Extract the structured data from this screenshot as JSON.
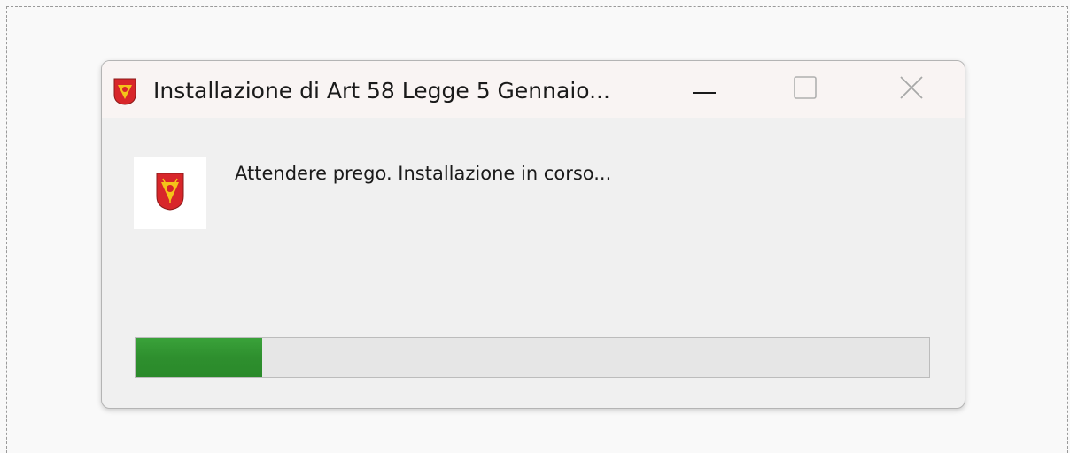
{
  "window": {
    "title": "Installazione di Art 58 Legge 5 Gennaio...",
    "minimize_icon": "minimize-icon",
    "maximize_icon": "maximize-icon",
    "close_icon": "close-icon",
    "app_icon": "sicily-coat-of-arms-icon"
  },
  "content": {
    "message": "Attendere prego. Installazione in corso...",
    "icon": "sicily-coat-of-arms-icon"
  },
  "progress": {
    "fraction": 0.16,
    "color": "#2e8f2e"
  },
  "colors": {
    "titlebar": "#f9f4f3",
    "window_bg": "#f0f0f0",
    "progress_track": "#e6e6e6"
  }
}
